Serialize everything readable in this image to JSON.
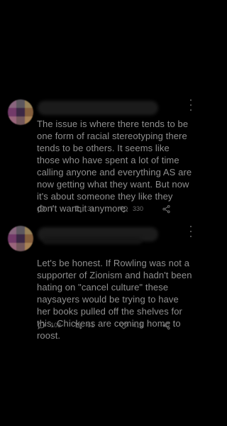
{
  "tweets": [
    {
      "text": "The issue is where there tends to be one form of racial stereotyping there tends to be others. It seems like those who have spent a lot of time calling anyone and everything AS are now getting what they want. But now it's about someone they like they don't want it anymore.",
      "replies": "7",
      "retweets": "31",
      "likes": "330"
    },
    {
      "text": "Let's be honest. If Rowling was not a supporter of Zionism and hadn't been hating on \"cancel culture\" these naysayers would be trying to have her books pulled off the shelves for this. Chickens are coming home to roost.",
      "replies": "103",
      "retweets": "61",
      "likes": "415"
    }
  ]
}
